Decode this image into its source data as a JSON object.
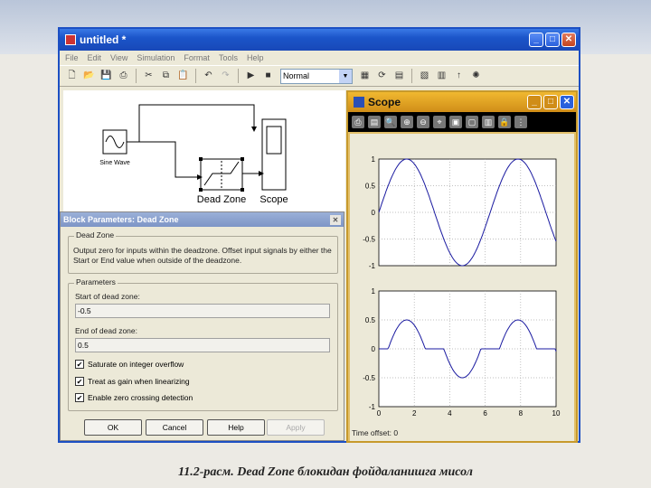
{
  "sim_window": {
    "title": "untitled *",
    "menu": [
      "File",
      "Edit",
      "View",
      "Simulation",
      "Format",
      "Tools",
      "Help"
    ],
    "mode": "Normal",
    "blocks": {
      "source": "Sine Wave",
      "deadzone": "Dead Zone",
      "scope": "Scope"
    }
  },
  "params": {
    "title": "Block Parameters: Dead Zone",
    "group1_label": "Dead Zone",
    "description": "Output zero for inputs within the deadzone.  Offset input signals by either the Start or End value when outside of the deadzone.",
    "group2_label": "Parameters",
    "start_label": "Start of dead zone:",
    "start_value": "-0.5",
    "end_label": "End of dead zone:",
    "end_value": "0.5",
    "checks": [
      {
        "label": "Saturate on integer overflow",
        "checked": true
      },
      {
        "label": "Treat as gain when linearizing",
        "checked": true
      },
      {
        "label": "Enable zero crossing detection",
        "checked": true
      }
    ],
    "buttons": {
      "ok": "OK",
      "cancel": "Cancel",
      "help": "Help",
      "apply": "Apply"
    }
  },
  "scope": {
    "title": "Scope",
    "time_offset_label": "Time offset:",
    "time_offset_value": "0"
  },
  "chart_data": [
    {
      "type": "line",
      "xlim": [
        0,
        10
      ],
      "ylim": [
        -1,
        1
      ],
      "grid": true,
      "yticks": [
        "1",
        "0.5",
        "0",
        "-0.5",
        "-1"
      ],
      "series": [
        {
          "function": "sin(t)",
          "x_range": [
            0,
            10
          ]
        }
      ]
    },
    {
      "type": "line",
      "xlim": [
        0,
        10
      ],
      "ylim": [
        -1,
        1
      ],
      "grid": true,
      "xticks": [
        "0",
        "2",
        "4",
        "6",
        "8",
        "10"
      ],
      "yticks": [
        "1",
        "0.5",
        "0",
        "-0.5",
        "-1"
      ],
      "series": [
        {
          "function": "deadzone(sin(t), -0.5, 0.5)",
          "x_range": [
            0,
            10
          ]
        }
      ]
    }
  ],
  "caption": "11.2-расм. Dead Zone блокидан фойдаланишга мисол",
  "colors": {
    "xp_blue": "#1b55c9",
    "scope_orange": "#e0a53a",
    "signal": "#1a1aa0"
  }
}
